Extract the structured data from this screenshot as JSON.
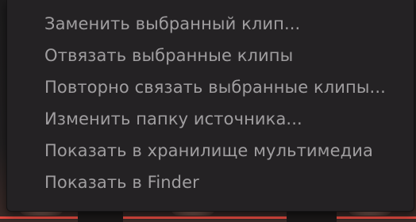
{
  "context_menu": {
    "items": [
      {
        "label": "Заменить выбранный клип..."
      },
      {
        "label": "Отвязать выбранные клипы"
      },
      {
        "label": "Повторно связать выбранные клипы..."
      },
      {
        "label": "Изменить папку источника..."
      },
      {
        "label": "Показать в хранилище мультимедиа"
      },
      {
        "label": "Показать в Finder"
      }
    ]
  },
  "colors": {
    "menu_background": "#242224",
    "menu_text": "#a09ea0",
    "clip_accent": "#e0483f"
  }
}
